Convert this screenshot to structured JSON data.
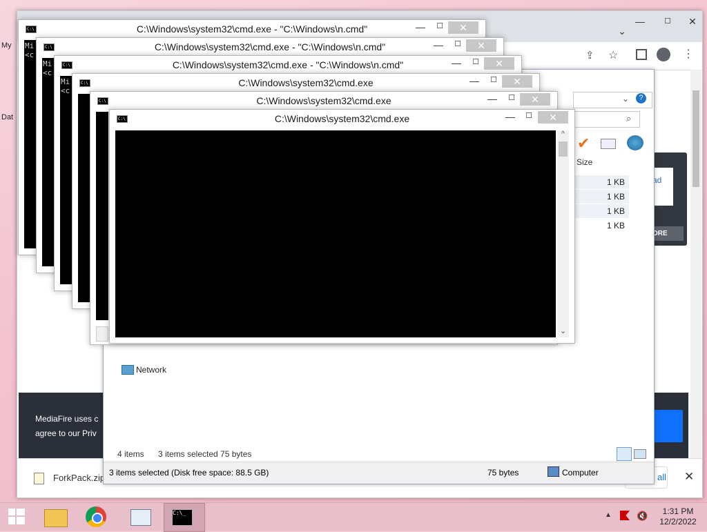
{
  "desktop": {
    "icons": [
      {
        "label": "My"
      },
      {
        "label": "Dat"
      }
    ]
  },
  "browser": {
    "banner_line1": "MediaFire uses c",
    "banner_line2": "agree to our Priv",
    "side_link": "ad",
    "side_button": "ORE",
    "download_file": "ForkPack.zip",
    "show_all": "all"
  },
  "explorer": {
    "column_size": "Size",
    "rows": [
      "1 KB",
      "1 KB",
      "1 KB",
      "1 KB"
    ],
    "nav_network": "Network",
    "items_count": "4 items",
    "items_selected": "3 items selected  75 bytes",
    "status_selected": "3 items selected (Disk free space: 88.5 GB)",
    "status_size": "75 bytes",
    "status_location": "Computer"
  },
  "cmd_windows": [
    {
      "title": "C:\\Windows\\system32\\cmd.exe - \"C:\\Windows\\n.cmd\"",
      "text": "Mi\n<c"
    },
    {
      "title": "C:\\Windows\\system32\\cmd.exe - \"C:\\Windows\\n.cmd\"",
      "text": "Mi\n<c"
    },
    {
      "title": "C:\\Windows\\system32\\cmd.exe - \"C:\\Windows\\n.cmd\"",
      "text": "Mi\n<c"
    },
    {
      "title": "C:\\Windows\\system32\\cmd.exe",
      "text": ""
    },
    {
      "title": "C:\\Windows\\system32\\cmd.exe",
      "text": ""
    },
    {
      "title": "C:\\Windows\\system32\\cmd.exe",
      "text": ""
    }
  ],
  "window_controls": {
    "minimize": "—",
    "maximize": "☐",
    "close": "✕"
  },
  "taskbar": {
    "time": "1:31 PM",
    "date": "12/2/2022"
  }
}
